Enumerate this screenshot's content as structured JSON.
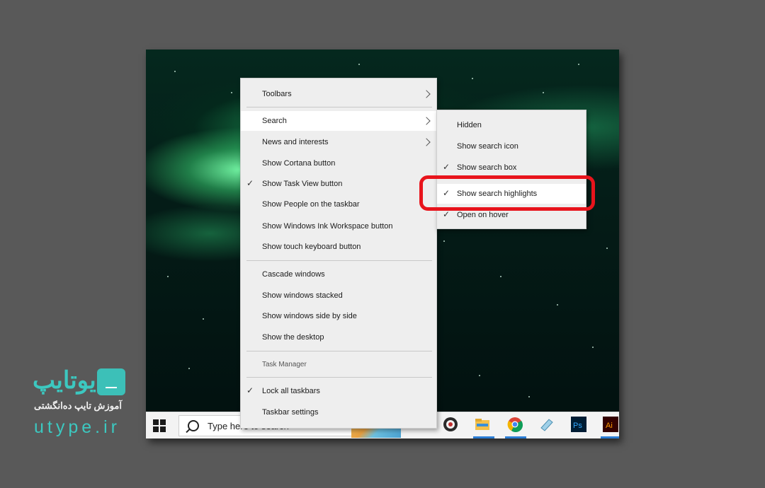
{
  "context_menu": {
    "items": [
      {
        "label": "Toolbars",
        "checked": false,
        "submenu": true
      },
      {
        "label": "Search",
        "checked": false,
        "submenu": true
      },
      {
        "label": "News and interests",
        "checked": false,
        "submenu": true
      },
      {
        "label": "Show Cortana button",
        "checked": false
      },
      {
        "label": "Show Task View button",
        "checked": true
      },
      {
        "label": "Show People on the taskbar",
        "checked": false
      },
      {
        "label": "Show Windows Ink Workspace button",
        "checked": false
      },
      {
        "label": "Show touch keyboard button",
        "checked": false
      },
      {
        "label": "Cascade windows",
        "checked": false
      },
      {
        "label": "Show windows stacked",
        "checked": false
      },
      {
        "label": "Show windows side by side",
        "checked": false
      },
      {
        "label": "Show the desktop",
        "checked": false
      },
      {
        "label": "Task Manager",
        "checked": false
      },
      {
        "label": "Lock all taskbars",
        "checked": true
      },
      {
        "label": "Taskbar settings",
        "checked": false
      }
    ],
    "check_glyph": "✓"
  },
  "search_submenu": {
    "items": [
      {
        "label": "Hidden",
        "checked": false
      },
      {
        "label": "Show search icon",
        "checked": false
      },
      {
        "label": "Show search box",
        "checked": true
      },
      {
        "label": "Show search highlights",
        "checked": true
      },
      {
        "label": "Open on hover",
        "checked": true
      }
    ]
  },
  "taskbar": {
    "search_placeholder": "Type here to search",
    "apps": [
      "obs-icon",
      "file-explorer-icon",
      "chrome-icon",
      "notepad-icon",
      "photoshop-icon",
      "illustrator-icon"
    ],
    "ps_label": "Ps",
    "ai_label": "Ai"
  },
  "logo": {
    "name_fa": "یوتایپ",
    "tagline_fa": "آموزش تایپ ده‌انگشتی",
    "url": "utype.ir"
  },
  "colors": {
    "highlight_frame": "#e8141c",
    "brand": "#3cc8c0",
    "menu_bg": "#eeeeee"
  }
}
